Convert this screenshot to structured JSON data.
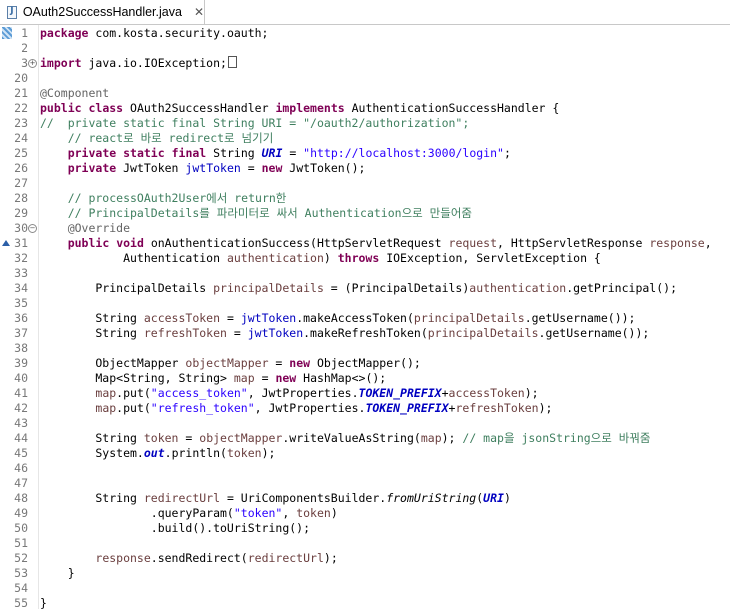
{
  "tab": {
    "icon_letter": "J",
    "title": "OAuth2SuccessHandler.java",
    "close_glyph": "✕",
    "modified_icon": "java-file-icon"
  },
  "editor": {
    "lines": [
      {
        "n": "1",
        "t": [
          [
            "k",
            "package"
          ],
          [
            "n",
            " com.kosta.security.oauth;"
          ]
        ]
      },
      {
        "n": "2",
        "t": []
      },
      {
        "n": "3",
        "fold": "+",
        "t": [
          [
            "k",
            "import"
          ],
          [
            "n",
            " java.io.IOException;"
          ],
          [
            "box",
            ""
          ]
        ]
      },
      {
        "n": "20",
        "t": []
      },
      {
        "n": "21",
        "t": [
          [
            "a",
            "@Component"
          ]
        ]
      },
      {
        "n": "22",
        "t": [
          [
            "k",
            "public"
          ],
          [
            "n",
            " "
          ],
          [
            "k",
            "class"
          ],
          [
            "n",
            " OAuth2SuccessHandler "
          ],
          [
            "k",
            "implements"
          ],
          [
            "n",
            " AuthenticationSuccessHandler {"
          ]
        ]
      },
      {
        "n": "23",
        "t": [
          [
            "c",
            "//  private static final String URI = \"/oauth2/authorization\";"
          ]
        ]
      },
      {
        "n": "24",
        "t": [
          [
            "c",
            "    // react로 바로 redirect로 넘기기"
          ]
        ]
      },
      {
        "n": "25",
        "t": [
          [
            "n",
            "    "
          ],
          [
            "k",
            "private"
          ],
          [
            "n",
            " "
          ],
          [
            "k",
            "static"
          ],
          [
            "n",
            " "
          ],
          [
            "k",
            "final"
          ],
          [
            "n",
            " String "
          ],
          [
            "fb",
            "URI"
          ],
          [
            "n",
            " = "
          ],
          [
            "s",
            "\"http://localhost:3000/login\""
          ],
          [
            "n",
            ";"
          ]
        ]
      },
      {
        "n": "26",
        "t": [
          [
            "n",
            "    "
          ],
          [
            "k",
            "private"
          ],
          [
            "n",
            " JwtToken "
          ],
          [
            "f",
            "jwtToken"
          ],
          [
            "n",
            " = "
          ],
          [
            "k",
            "new"
          ],
          [
            "n",
            " JwtToken();"
          ]
        ]
      },
      {
        "n": "27",
        "t": []
      },
      {
        "n": "28",
        "t": [
          [
            "c",
            "    // processOAuth2User에서 return한"
          ]
        ]
      },
      {
        "n": "29",
        "t": [
          [
            "c",
            "    // PrincipalDetails를 파라미터로 싸서 Authentication으로 만들어줌"
          ]
        ]
      },
      {
        "n": "30",
        "fold": "−",
        "t": [
          [
            "n",
            "    "
          ],
          [
            "a",
            "@Override"
          ]
        ]
      },
      {
        "n": "31",
        "override": true,
        "t": [
          [
            "n",
            "    "
          ],
          [
            "k",
            "public"
          ],
          [
            "n",
            " "
          ],
          [
            "k",
            "void"
          ],
          [
            "n",
            " onAuthenticationSuccess(HttpServletRequest "
          ],
          [
            "p",
            "request"
          ],
          [
            "n",
            ", HttpServletResponse "
          ],
          [
            "p",
            "response"
          ],
          [
            "n",
            ","
          ]
        ]
      },
      {
        "n": "32",
        "t": [
          [
            "n",
            "            Authentication "
          ],
          [
            "p",
            "authentication"
          ],
          [
            "n",
            ") "
          ],
          [
            "k",
            "throws"
          ],
          [
            "n",
            " IOException, ServletException {"
          ]
        ]
      },
      {
        "n": "33",
        "t": []
      },
      {
        "n": "34",
        "t": [
          [
            "n",
            "        PrincipalDetails "
          ],
          [
            "p",
            "principalDetails"
          ],
          [
            "n",
            " = (PrincipalDetails)"
          ],
          [
            "p",
            "authentication"
          ],
          [
            "n",
            ".getPrincipal();"
          ]
        ]
      },
      {
        "n": "35",
        "t": []
      },
      {
        "n": "36",
        "t": [
          [
            "n",
            "        String "
          ],
          [
            "p",
            "accessToken"
          ],
          [
            "n",
            " = "
          ],
          [
            "f",
            "jwtToken"
          ],
          [
            "n",
            ".makeAccessToken("
          ],
          [
            "p",
            "principalDetails"
          ],
          [
            "n",
            ".getUsername());"
          ]
        ]
      },
      {
        "n": "37",
        "t": [
          [
            "n",
            "        String "
          ],
          [
            "p",
            "refreshToken"
          ],
          [
            "n",
            " = "
          ],
          [
            "f",
            "jwtToken"
          ],
          [
            "n",
            ".makeRefreshToken("
          ],
          [
            "p",
            "principalDetails"
          ],
          [
            "n",
            ".getUsername());"
          ]
        ]
      },
      {
        "n": "38",
        "t": []
      },
      {
        "n": "39",
        "t": [
          [
            "n",
            "        ObjectMapper "
          ],
          [
            "p",
            "objectMapper"
          ],
          [
            "n",
            " = "
          ],
          [
            "k",
            "new"
          ],
          [
            "n",
            " ObjectMapper();"
          ]
        ]
      },
      {
        "n": "40",
        "t": [
          [
            "n",
            "        Map<String, String> "
          ],
          [
            "p",
            "map"
          ],
          [
            "n",
            " = "
          ],
          [
            "k",
            "new"
          ],
          [
            "n",
            " HashMap<>();"
          ]
        ]
      },
      {
        "n": "41",
        "t": [
          [
            "n",
            "        "
          ],
          [
            "p",
            "map"
          ],
          [
            "n",
            ".put("
          ],
          [
            "s",
            "\"access_token\""
          ],
          [
            "n",
            ", JwtProperties."
          ],
          [
            "fb",
            "TOKEN_PREFIX"
          ],
          [
            "n",
            "+"
          ],
          [
            "p",
            "accessToken"
          ],
          [
            "n",
            ");"
          ]
        ]
      },
      {
        "n": "42",
        "t": [
          [
            "n",
            "        "
          ],
          [
            "p",
            "map"
          ],
          [
            "n",
            ".put("
          ],
          [
            "s",
            "\"refresh_token\""
          ],
          [
            "n",
            ", JwtProperties."
          ],
          [
            "fb",
            "TOKEN_PREFIX"
          ],
          [
            "n",
            "+"
          ],
          [
            "p",
            "refreshToken"
          ],
          [
            "n",
            ");"
          ]
        ]
      },
      {
        "n": "43",
        "t": []
      },
      {
        "n": "44",
        "t": [
          [
            "n",
            "        String "
          ],
          [
            "p",
            "token"
          ],
          [
            "n",
            " = "
          ],
          [
            "p",
            "objectMapper"
          ],
          [
            "n",
            ".writeValueAsString("
          ],
          [
            "p",
            "map"
          ],
          [
            "n",
            "); "
          ],
          [
            "c",
            "// map을 jsonString으로 바꿔줌"
          ]
        ]
      },
      {
        "n": "45",
        "t": [
          [
            "n",
            "        System."
          ],
          [
            "fb",
            "out"
          ],
          [
            "n",
            ".println("
          ],
          [
            "p",
            "token"
          ],
          [
            "n",
            ");"
          ]
        ]
      },
      {
        "n": "46",
        "t": []
      },
      {
        "n": "47",
        "t": []
      },
      {
        "n": "48",
        "t": [
          [
            "n",
            "        String "
          ],
          [
            "p",
            "redirectUrl"
          ],
          [
            "n",
            " = UriComponentsBuilder."
          ],
          [
            "m",
            "fromUriString"
          ],
          [
            "n",
            "("
          ],
          [
            "fb",
            "URI"
          ],
          [
            "n",
            ")"
          ]
        ]
      },
      {
        "n": "49",
        "t": [
          [
            "n",
            "                .queryParam("
          ],
          [
            "s",
            "\"token\""
          ],
          [
            "n",
            ", "
          ],
          [
            "p",
            "token"
          ],
          [
            "n",
            ")"
          ]
        ]
      },
      {
        "n": "50",
        "t": [
          [
            "n",
            "                .build().toUriString();"
          ]
        ]
      },
      {
        "n": "51",
        "t": []
      },
      {
        "n": "52",
        "t": [
          [
            "n",
            "        "
          ],
          [
            "p",
            "response"
          ],
          [
            "n",
            ".sendRedirect("
          ],
          [
            "p",
            "redirectUrl"
          ],
          [
            "n",
            ");"
          ]
        ]
      },
      {
        "n": "53",
        "t": [
          [
            "n",
            "    }"
          ]
        ]
      },
      {
        "n": "54",
        "t": []
      },
      {
        "n": "55",
        "t": [
          [
            "n",
            "}"
          ]
        ]
      }
    ]
  }
}
